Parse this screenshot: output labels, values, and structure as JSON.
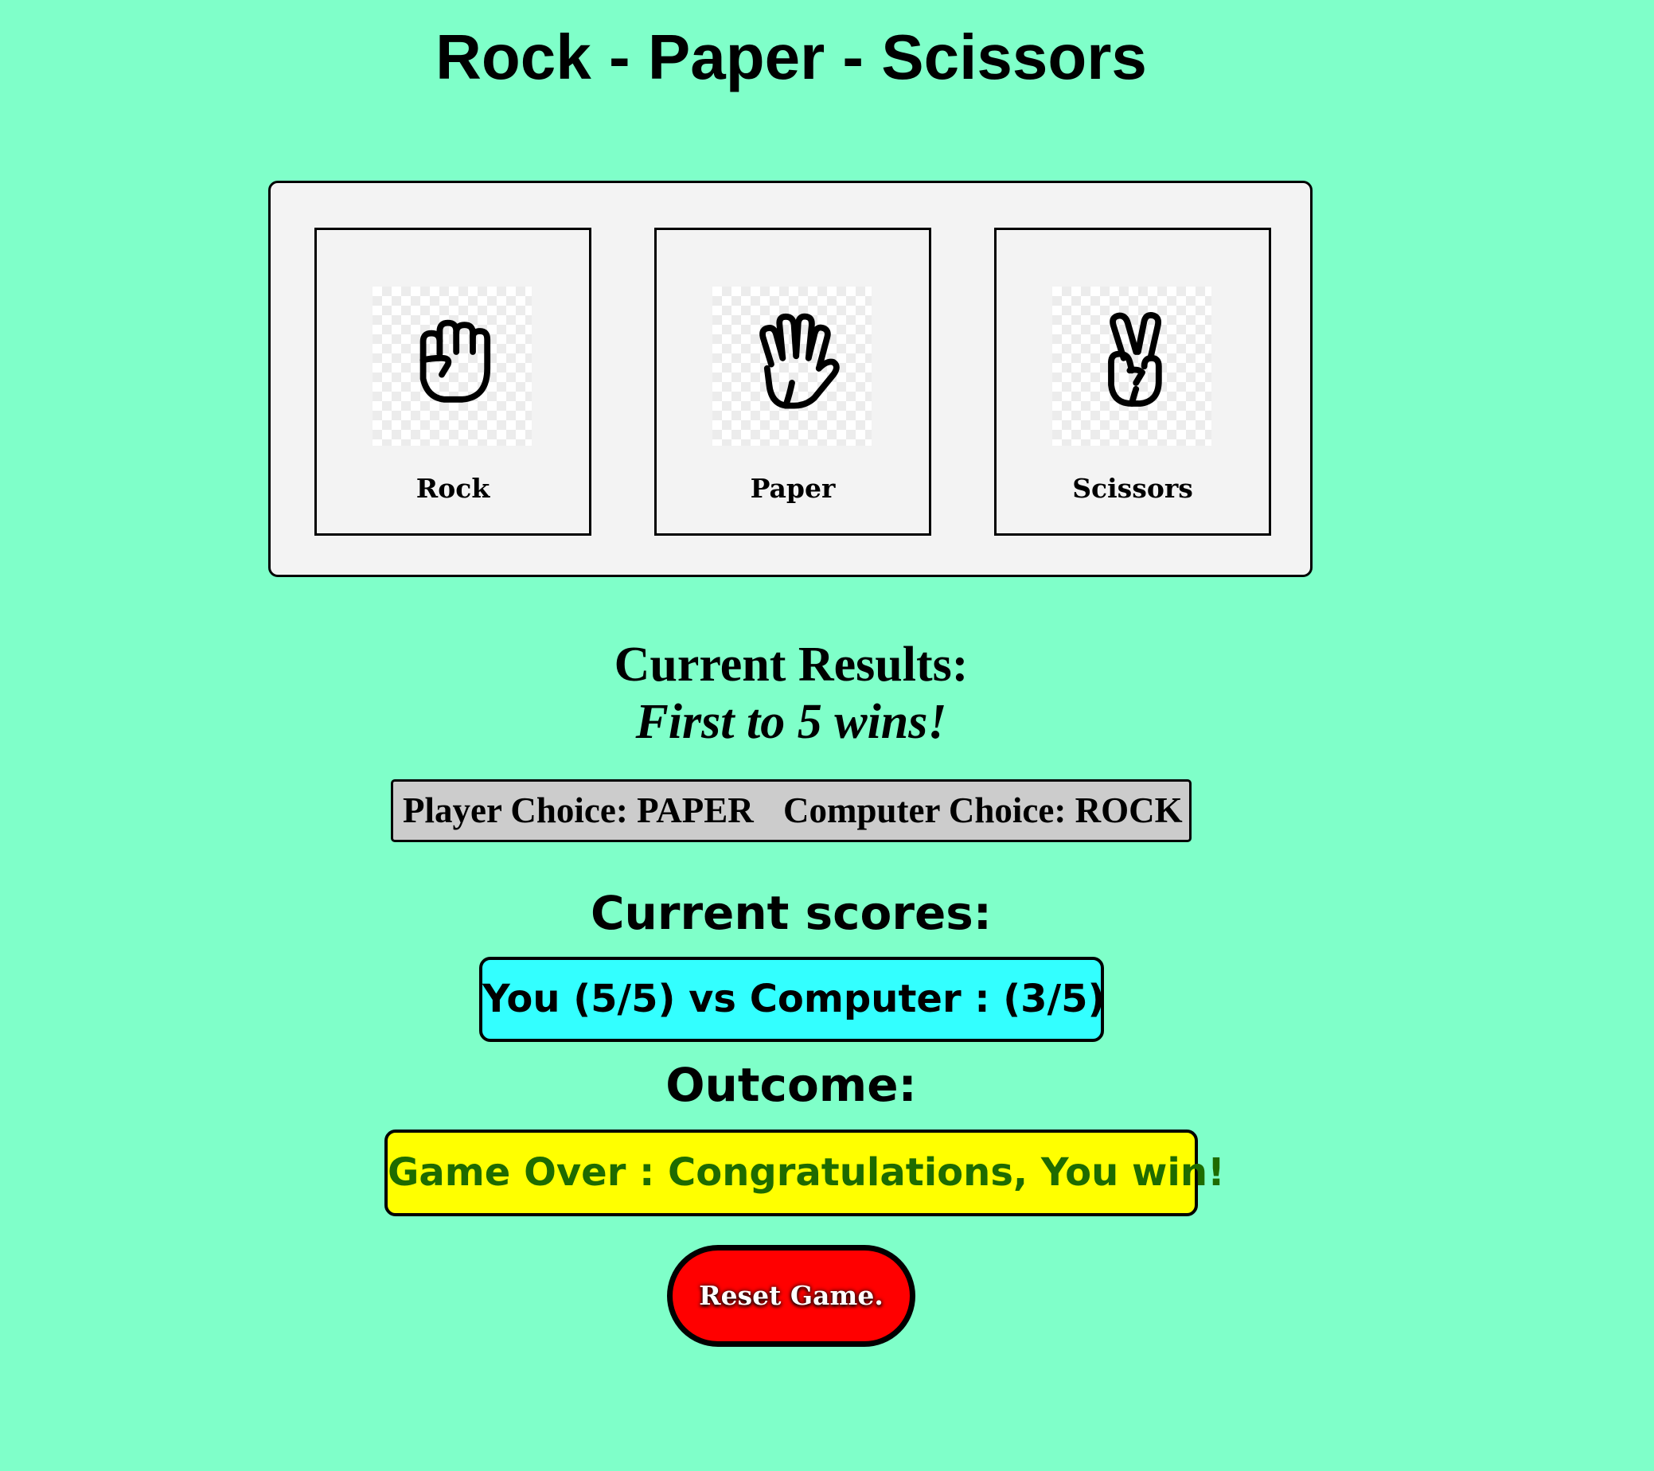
{
  "title": "Rock - Paper - Scissors",
  "choices": [
    {
      "label": "Rock",
      "icon": "fist-icon"
    },
    {
      "label": "Paper",
      "icon": "open-hand-icon"
    },
    {
      "label": "Scissors",
      "icon": "peace-hand-icon"
    }
  ],
  "results": {
    "heading": "Current Results:",
    "subheading": "First to 5 wins!",
    "player_choice": "Player Choice: PAPER",
    "computer_choice": "Computer Choice: ROCK"
  },
  "scores": {
    "heading": "Current scores:",
    "text": "You (5/5) vs Computer : (3/5)"
  },
  "outcome": {
    "heading": "Outcome:",
    "text": "Game Over : Congratulations, You win!"
  },
  "reset_label": "Reset Game.",
  "colors": {
    "background": "#7fffc9",
    "score_box": "#33ffff",
    "outcome_box": "#ffff00",
    "outcome_text": "#1e6b00",
    "reset_button": "#ff0000"
  }
}
